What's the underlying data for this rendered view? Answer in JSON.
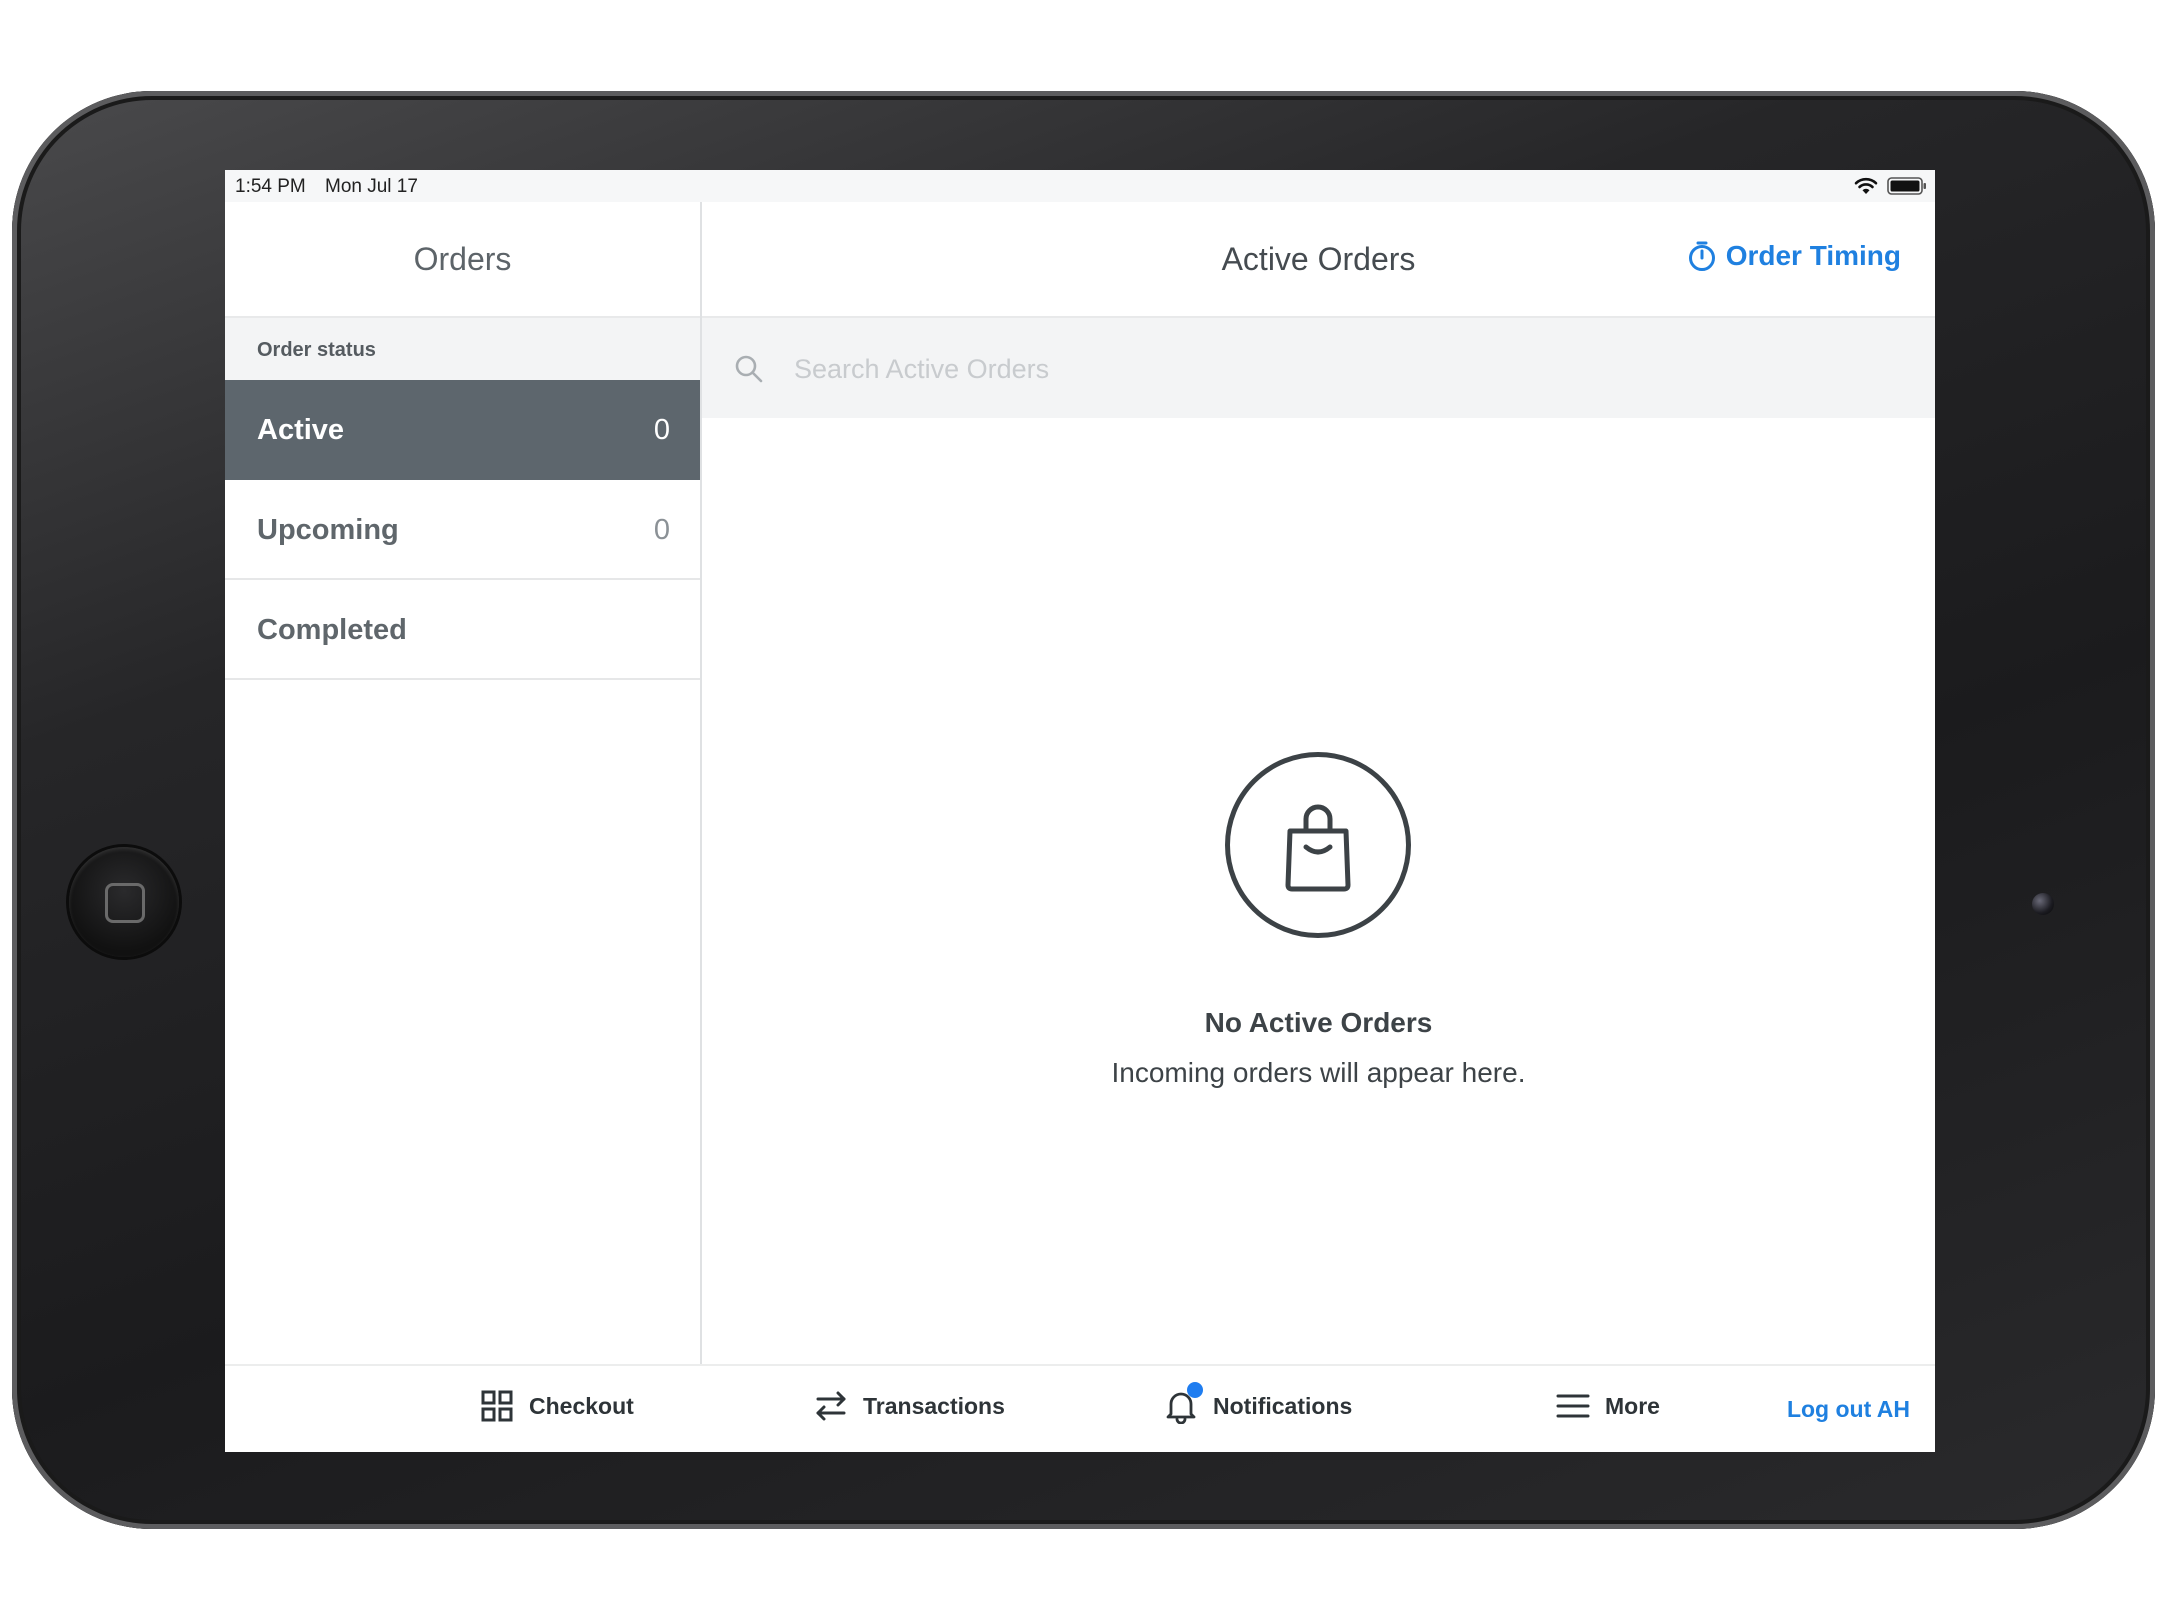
{
  "status_bar": {
    "time": "1:54 PM",
    "date": "Mon Jul 17"
  },
  "sidebar": {
    "title": "Orders",
    "section_label": "Order status",
    "items": [
      {
        "label": "Active",
        "count": "0"
      },
      {
        "label": "Upcoming",
        "count": "0"
      },
      {
        "label": "Completed",
        "count": ""
      }
    ]
  },
  "main": {
    "title": "Active Orders",
    "order_timing_label": "Order Timing",
    "search": {
      "placeholder": "Search Active Orders",
      "value": ""
    },
    "empty_state": {
      "icon": "shopping-bag-icon",
      "title": "No Active Orders",
      "subtitle": "Incoming orders will appear here."
    }
  },
  "tab_bar": {
    "checkout": "Checkout",
    "transactions": "Transactions",
    "notifications": "Notifications",
    "more": "More",
    "logout": "Log out AH"
  },
  "colors": {
    "accent": "#1f80e0",
    "active_row": "#5d666d",
    "notification_dot": "#1f7df0"
  }
}
